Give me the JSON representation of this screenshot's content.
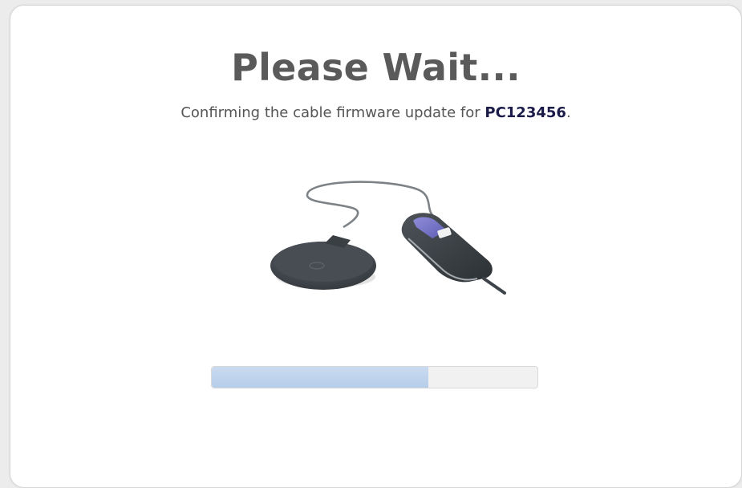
{
  "dialog": {
    "title": "Please Wait...",
    "message_prefix": "Confirming the cable firmware update for ",
    "device_id": "PC123456",
    "message_suffix": ".",
    "device_image_icon": "cable-and-charging-pad-icon",
    "progress": {
      "value_fraction": 0.665,
      "track_color": "#f1f1f1",
      "fill_color": "#b6cde9"
    }
  }
}
